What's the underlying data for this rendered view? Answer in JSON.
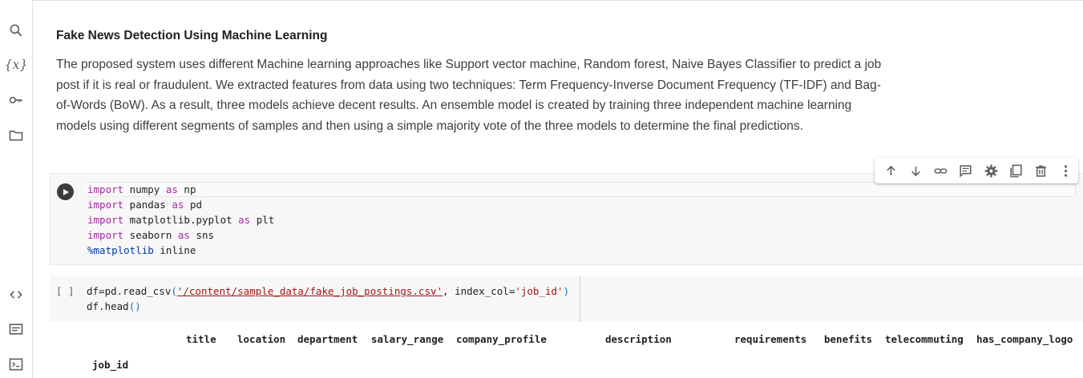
{
  "sidebar": {
    "icons": [
      "search-icon",
      "variables-icon",
      "key-icon",
      "folder-icon",
      "code-icon",
      "terminal-list-icon",
      "terminal-icon"
    ],
    "variables_label": "{x}"
  },
  "text_cell": {
    "heading": "Fake News Detection Using Machine Learning",
    "paragraph": "The proposed system uses different Machine learning approaches like Support vector machine, Random forest, Naive Bayes Classifier to predict a job post if it is real or fraudulent. We extracted features from data using two techniques: Term Frequency-Inverse Document Frequency (TF-IDF) and Bag-of-Words (BoW). As a result, three models achieve decent results. An ensemble model is created by training three independent machine learning models using different segments of samples and then using a simple majority vote of the three models to determine the final predictions."
  },
  "toolbar": {
    "buttons": [
      "arrow-up-icon",
      "arrow-down-icon",
      "link-icon",
      "comment-icon",
      "settings-icon",
      "mirror-cell-icon",
      "delete-icon",
      "more-icon"
    ]
  },
  "code_cell_1": {
    "lines": [
      {
        "kw": "import",
        "rest": " numpy ",
        "kw2": "as",
        "rest2": " np"
      },
      {
        "kw": "import",
        "rest": " pandas ",
        "kw2": "as",
        "rest2": " pd"
      },
      {
        "kw": "import",
        "rest": " matplotlib.pyplot ",
        "kw2": "as",
        "rest2": " plt"
      },
      {
        "kw": "import",
        "rest": " seaborn ",
        "kw2": "as",
        "rest2": " sns"
      }
    ],
    "magic": "%matplotlib",
    "magic_rest": " inline"
  },
  "code_cell_2": {
    "bracket": "[ ]",
    "line1_a": "df=pd.read_csv",
    "line1_open": "(",
    "line1_str": "'/content/sample_data/fake_job_postings.csv'",
    "line1_mid": ", index_col=",
    "line1_str2": "'job_id'",
    "line1_close": ")",
    "line2_a": "df.head",
    "line2_paren": "()"
  },
  "output": {
    "columns": [
      "title",
      "location",
      "department",
      "salary_range",
      "company_profile",
      "description",
      "requirements",
      "benefits",
      "telecommuting",
      "has_company_logo"
    ],
    "index_name": "job_id"
  }
}
